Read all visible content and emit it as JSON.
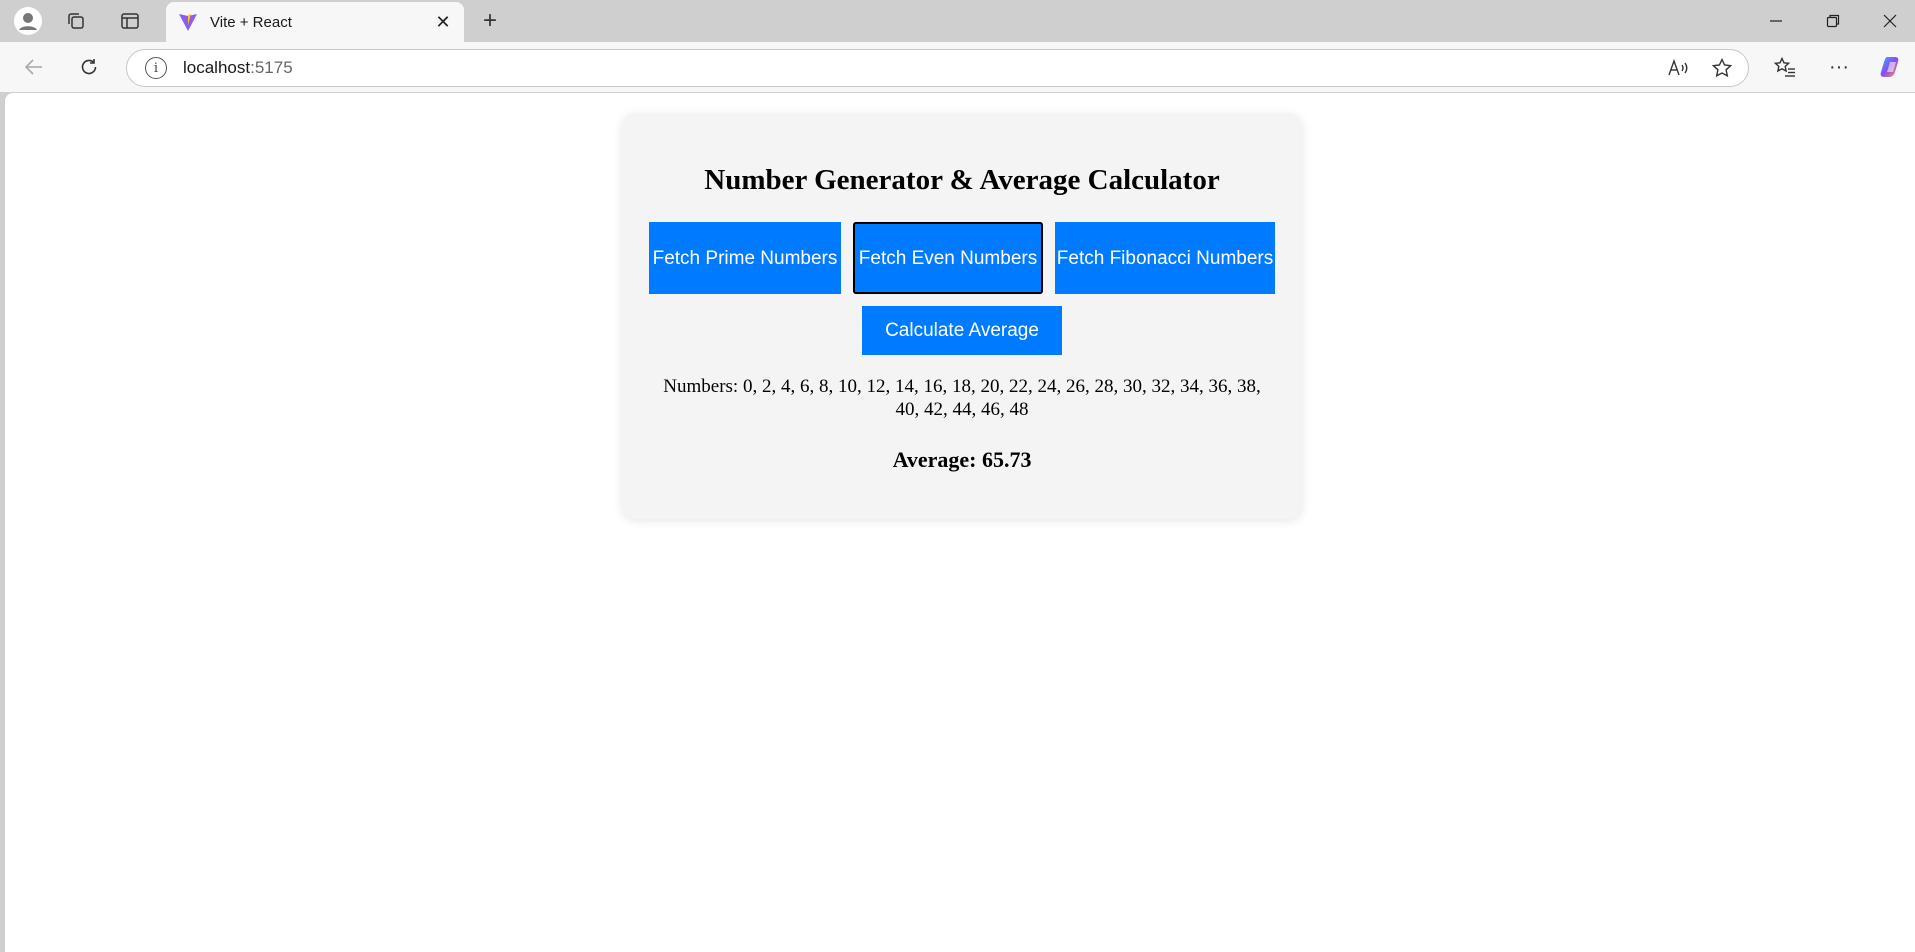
{
  "browser": {
    "tab_title": "Vite + React",
    "url_host": "localhost",
    "url_port": ":5175"
  },
  "app": {
    "title": "Number Generator & Average Calculator",
    "buttons": {
      "prime": "Fetch Prime Numbers",
      "even": "Fetch Even Numbers",
      "fibonacci": "Fetch Fibonacci Numbers",
      "average": "Calculate Average"
    },
    "numbers_text": "Numbers: 0, 2, 4, 6, 8, 10, 12, 14, 16, 18, 20, 22, 24, 26, 28, 30, 32, 34, 36, 38, 40, 42, 44, 46, 48",
    "average_text": "Average: 65.73"
  },
  "colors": {
    "button_blue": "#007bff",
    "card_background": "#f4f4f4"
  }
}
